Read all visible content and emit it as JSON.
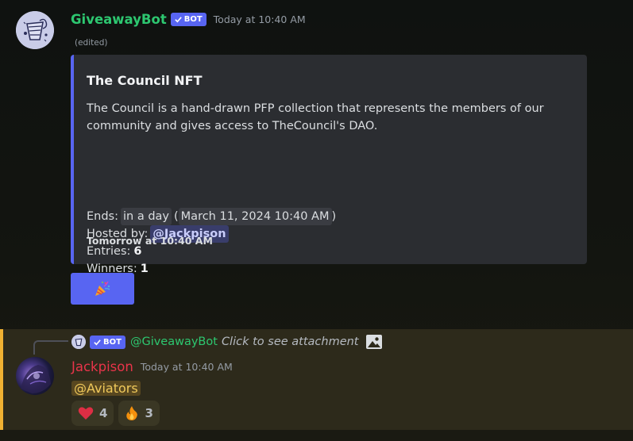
{
  "message1": {
    "author": "GiveawayBot",
    "bot_tag": "BOT",
    "timestamp": "Today at 10:40 AM",
    "edited": "(edited)",
    "embed": {
      "title": "The Council NFT",
      "description": "The Council is a hand-drawn PFP collection that represents the members of our community and gives access to TheCouncil's DAO.",
      "ends_label": "Ends:",
      "ends_relative": "in a day",
      "ends_paren_open": "(",
      "ends_absolute": "March 11, 2024 10:40 AM",
      "ends_paren_close": ")",
      "hosted_label": "Hosted by:",
      "host": "@Jackpison",
      "entries_label": "Entries:",
      "entries": "6",
      "winners_label": "Winners:",
      "winners": "1",
      "footer": "Tomorrow at 10:40 AM",
      "accent_color": "#5865f2"
    },
    "button": {
      "icon": "party-popper-icon"
    }
  },
  "message2": {
    "reply": {
      "bot_tag": "BOT",
      "mention": "@GiveawayBot",
      "content": "Click to see attachment",
      "icon": "image-icon"
    },
    "author": "Jackpison",
    "timestamp": "Today at 10:40 AM",
    "content": "@Aviators",
    "highlight_color": "#f0b132",
    "reactions": [
      {
        "emoji": "heart-icon",
        "count": "4"
      },
      {
        "emoji": "fire-icon",
        "count": "3"
      }
    ]
  }
}
